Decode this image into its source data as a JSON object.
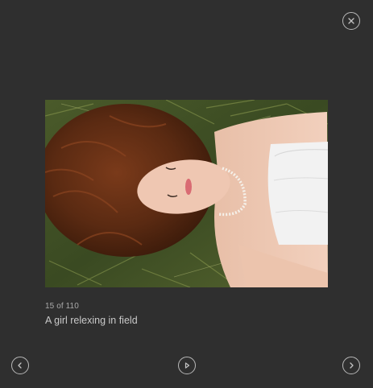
{
  "lightbox": {
    "counter": "15 of 110",
    "caption": "A girl relexing in field",
    "controls": {
      "close_icon": "close-icon",
      "prev_icon": "chevron-left-icon",
      "play_icon": "play-icon",
      "next_icon": "chevron-right-icon"
    }
  },
  "colors": {
    "background": "#2f2f2f",
    "control_stroke": "#b9b9b9",
    "counter_text": "#a9a9a9",
    "caption_text": "#c9c9c9"
  }
}
